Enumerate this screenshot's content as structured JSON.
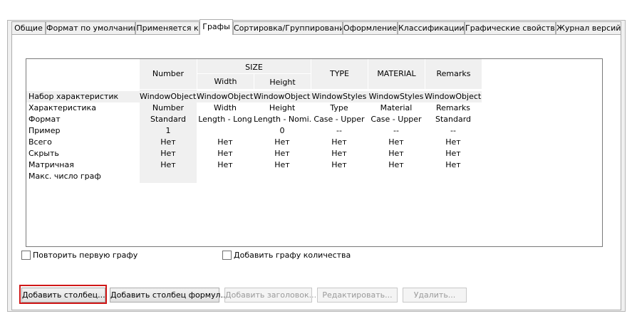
{
  "tabs": [
    "Общие",
    "Формат по умолчанию",
    "Применяется к",
    "Графы",
    "Сортировка/Группирование",
    "Оформление",
    "Классификации",
    "Графические свойства",
    "Журнал версий"
  ],
  "active_tab": "Графы",
  "grid": {
    "headers": {
      "number": "Number",
      "size": "SIZE",
      "width": "Width",
      "height": "Height",
      "type": "TYPE",
      "material": "MATERIAL",
      "remarks": "Remarks"
    },
    "rows": [
      {
        "label": "Набор характеристик",
        "cells": [
          "WindowObjects",
          "WindowObjects",
          "WindowObjects",
          "WindowStyles",
          "WindowStyles",
          "WindowObjects"
        ]
      },
      {
        "label": "Характеристика",
        "cells": [
          "Number",
          "Width",
          "Height",
          "Type",
          "Material",
          "Remarks"
        ]
      },
      {
        "label": "Формат",
        "cells": [
          "Standard",
          "Length - Long",
          "Length - Nomi...",
          "Case - Upper",
          "Case - Upper",
          "Standard"
        ]
      },
      {
        "label": "Пример",
        "cells": [
          "1",
          "",
          "0",
          "--",
          "--",
          "--"
        ]
      },
      {
        "label": "Всего",
        "cells": [
          "Нет",
          "Нет",
          "Нет",
          "Нет",
          "Нет",
          "Нет"
        ]
      },
      {
        "label": "Скрыть",
        "cells": [
          "Нет",
          "Нет",
          "Нет",
          "Нет",
          "Нет",
          "Нет"
        ]
      },
      {
        "label": "Матричная",
        "cells": [
          "Нет",
          "Нет",
          "Нет",
          "Нет",
          "Нет",
          "Нет"
        ]
      },
      {
        "label": "Макс. число граф",
        "cells": [
          "",
          "",
          "",
          "",
          "",
          ""
        ]
      }
    ]
  },
  "checkboxes": {
    "repeat_first": {
      "label": "Повторить первую графу",
      "checked": false
    },
    "add_qty": {
      "label": "Добавить графу количества",
      "checked": false
    }
  },
  "buttons": {
    "add_column": "Добавить столбец...",
    "add_formula_column": "Добавить столбец формул...",
    "add_header": "Добавить заголовок...",
    "edit": "Редактировать...",
    "delete": "Удалить..."
  }
}
